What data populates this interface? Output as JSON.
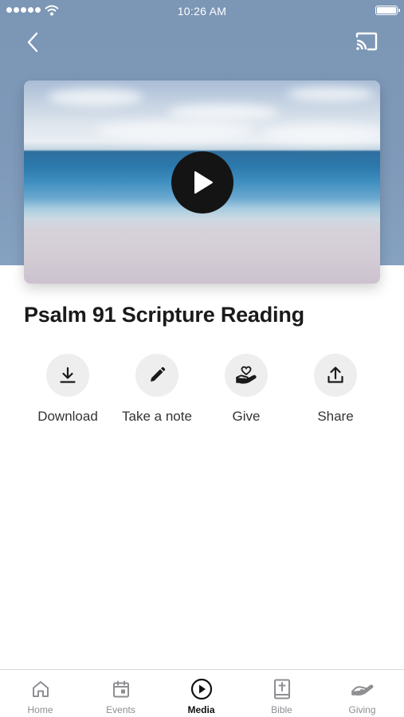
{
  "status_bar": {
    "time": "10:26 AM"
  },
  "media": {
    "title": "Psalm 91 Scripture Reading"
  },
  "actions": [
    {
      "label": "Download",
      "icon": "download-icon"
    },
    {
      "label": "Take a note",
      "icon": "pencil-icon"
    },
    {
      "label": "Give",
      "icon": "giving-hand-heart-icon"
    },
    {
      "label": "Share",
      "icon": "share-icon"
    }
  ],
  "tabs": [
    {
      "label": "Home",
      "icon": "home-icon",
      "active": false
    },
    {
      "label": "Events",
      "icon": "calendar-icon",
      "active": false
    },
    {
      "label": "Media",
      "icon": "play-circle-icon",
      "active": true
    },
    {
      "label": "Bible",
      "icon": "bible-icon",
      "active": false
    },
    {
      "label": "Giving",
      "icon": "giving-hand-icon",
      "active": false
    }
  ],
  "colors": {
    "header_background": "#7e99b9",
    "action_circle": "#eeeeee",
    "active_tab": "#111111",
    "inactive_tab": "#8e8e93"
  }
}
